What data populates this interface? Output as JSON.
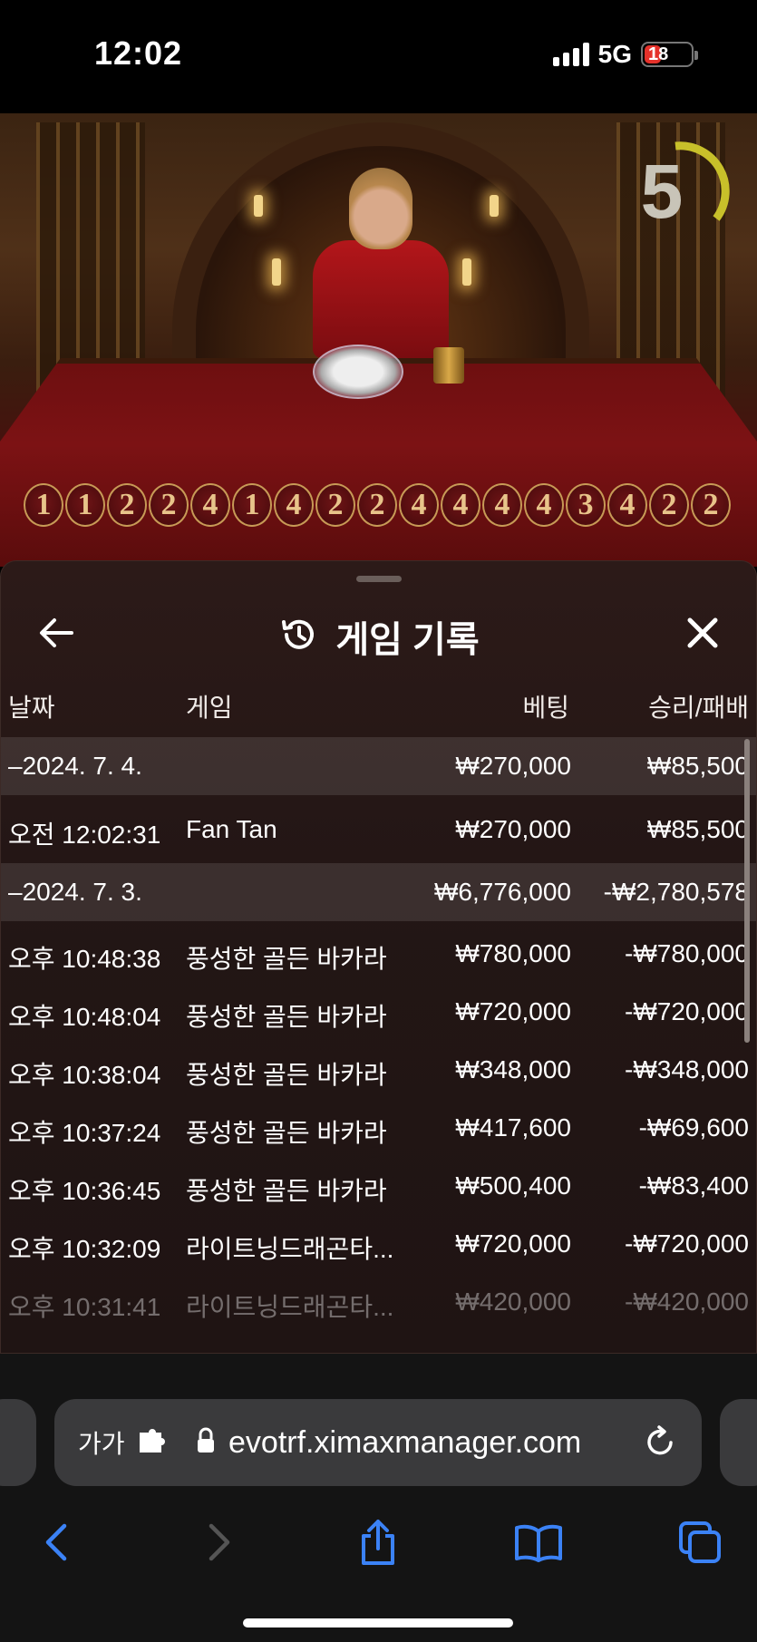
{
  "status": {
    "time": "12:02",
    "network": "5G",
    "battery": "18"
  },
  "game": {
    "countdown": "5",
    "history": [
      "1",
      "1",
      "2",
      "2",
      "4",
      "1",
      "4",
      "2",
      "2",
      "4",
      "4",
      "4",
      "4",
      "3",
      "4",
      "2",
      "2"
    ]
  },
  "panel": {
    "title": "게임 기록",
    "columns": {
      "date": "날짜",
      "game": "게임",
      "bet": "베팅",
      "result": "승리/패배"
    },
    "rows": [
      {
        "date": "–2024. 7. 4.",
        "game": "",
        "bet": "₩270,000",
        "result": "₩85,500"
      },
      {
        "date": "오전 12:02:31",
        "game": "Fan Tan",
        "bet": "₩270,000",
        "result": "₩85,500"
      },
      {
        "date": "–2024. 7. 3.",
        "game": "",
        "bet": "₩6,776,000",
        "result": "-₩2,780,578"
      },
      {
        "date": "오후 10:48:38",
        "game": "풍성한 골든 바카라",
        "bet": "₩780,000",
        "result": "-₩780,000"
      },
      {
        "date": "오후 10:48:04",
        "game": "풍성한 골든 바카라",
        "bet": "₩720,000",
        "result": "-₩720,000"
      },
      {
        "date": "오후 10:38:04",
        "game": "풍성한 골든 바카라",
        "bet": "₩348,000",
        "result": "-₩348,000"
      },
      {
        "date": "오후 10:37:24",
        "game": "풍성한 골든 바카라",
        "bet": "₩417,600",
        "result": "-₩69,600"
      },
      {
        "date": "오후 10:36:45",
        "game": "풍성한 골든 바카라",
        "bet": "₩500,400",
        "result": "-₩83,400"
      },
      {
        "date": "오후 10:32:09",
        "game": "라이트닝드래곤타...",
        "bet": "₩720,000",
        "result": "-₩720,000"
      },
      {
        "date": "오후 10:31:41",
        "game": "라이트닝드래곤타...",
        "bet": "₩420,000",
        "result": "-₩420,000"
      }
    ]
  },
  "browser": {
    "text_size_label": "가가",
    "url": "evotrf.ximaxmanager.com"
  },
  "colors": {
    "accent": "#3b82f6",
    "panel_bg": "#231615",
    "table_red": "#7c1214"
  }
}
